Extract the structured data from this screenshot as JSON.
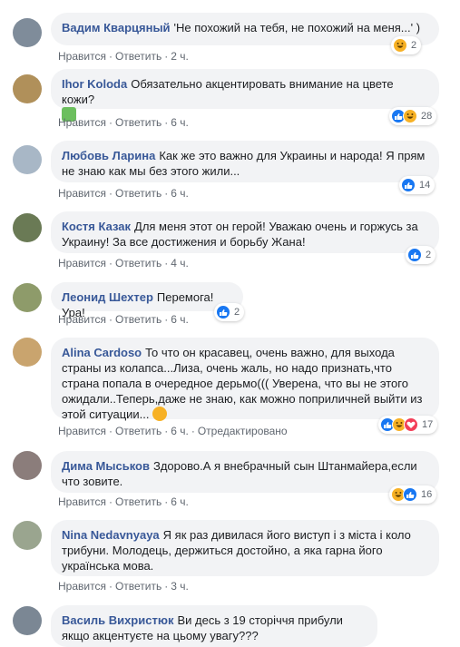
{
  "action_labels": {
    "like": "Нравится",
    "reply": "Ответить",
    "edited": "Отредактировано"
  },
  "comments": [
    {
      "author": "Вадим Кварцяный",
      "text": "'Не похожий на тебя, не похожий на меня...' )",
      "time": "2 ч.",
      "reactions": [
        "haha"
      ],
      "count": "2",
      "avatar_color": "#7f8c9a"
    },
    {
      "author": "Ihor Koloda",
      "text": "Обязательно акцентировать внимание на цвете кожи?",
      "emoji": "face-palm-icon",
      "time": "6 ч.",
      "reactions": [
        "like",
        "haha"
      ],
      "count": "28",
      "avatar_color": "#b0905a"
    },
    {
      "author": "Любовь Ларина",
      "text": "Как же это важно для Украины и народа! Я прям не знаю как мы без этого жили...",
      "time": "6 ч.",
      "reactions": [
        "like"
      ],
      "count": "14",
      "avatar_color": "#a8b7c6"
    },
    {
      "author": "Костя Казак",
      "text": "Для меня этот он герой! Уважаю очень и горжусь за Украину! За все достижения и борьбу Жана!",
      "time": "4 ч.",
      "reactions": [
        "like"
      ],
      "count": "2",
      "avatar_color": "#6a7a55"
    },
    {
      "author": "Леонид Шехтер",
      "text": "Перемога! Ура!",
      "time": "6 ч.",
      "reactions": [
        "like"
      ],
      "count": "2",
      "avatar_color": "#8e9b6a"
    },
    {
      "author": "Alina Cardoso",
      "text": "То что он красавец, очень важно, для выхода страны из колапса...Лиза, очень жаль, но надо признать,что страна попала в очередное дерьмо((( Уверена, что вы не этого ожидали..Теперь,даже не знаю, как можно поприличней выйти из этой ситуации...",
      "emoji": "thinking-face-icon",
      "time": "6 ч.",
      "edited": true,
      "reactions": [
        "like",
        "haha",
        "love"
      ],
      "count": "17",
      "avatar_color": "#c9a46e"
    },
    {
      "author": "Дима Мыськов",
      "text": "Здорово.А я внебрачный сын Штанмайера,если что зовите.",
      "time": "6 ч.",
      "reactions": [
        "haha",
        "like"
      ],
      "count": "16",
      "avatar_color": "#8b7d7b"
    },
    {
      "author": "Nina Nedavnyaya",
      "text": "Я як раз дивилася його виступ і з міста і коло трибуни. Молодець, держиться достойно, а яка гарна його українська мова.",
      "time": "3 ч.",
      "reactions": [],
      "count": "",
      "avatar_color": "#9aa58f"
    },
    {
      "author": "Василь Вихристюк",
      "text": "Ви десь з 19 сторіччя прибули якщо акцентуєте на цьому увагу???",
      "time": "",
      "reactions": [],
      "count": "",
      "avatar_color": "#7b8794"
    }
  ]
}
